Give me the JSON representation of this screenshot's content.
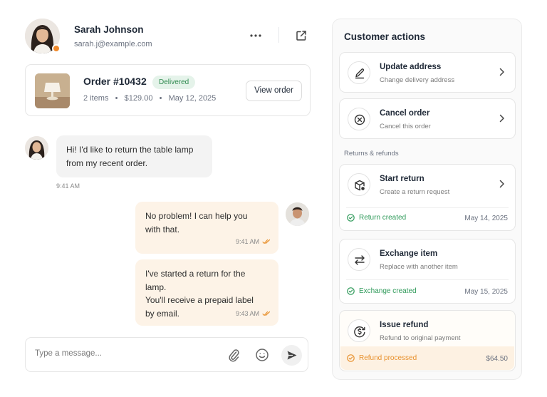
{
  "customer": {
    "name": "Sarah Johnson",
    "email": "sarah.j@example.com",
    "status_color": "#f08a2c"
  },
  "header": {
    "more_icon": "more-horizontal-icon",
    "open_icon": "external-link-icon"
  },
  "order": {
    "title": "Order #10432",
    "status": "Delivered",
    "items": "2 items",
    "total": "$129.00",
    "date": "May 12, 2025",
    "view_label": "View order"
  },
  "messages": [
    {
      "sender": "customer",
      "text": "Hi! I'd like to return the table lamp\nfrom my recent order.",
      "time": "9:41 AM"
    },
    {
      "sender": "agent",
      "text": "No problem! I can help you\nwith that.",
      "time": "9:41 AM"
    },
    {
      "sender": "agent",
      "text": "I've started a return for the lamp.\nYou'll receive a prepaid label\nby email.",
      "time": "9:43 AM"
    }
  ],
  "composer": {
    "placeholder": "Type a message...",
    "icons": [
      "paperclip-icon",
      "emoji-icon",
      "send-icon"
    ]
  },
  "panel": {
    "title": "Customer actions",
    "section_label": "Returns & refunds",
    "actions": [
      {
        "title": "Update address",
        "subtitle": "Change delivery address",
        "icon": "pencil-icon"
      },
      {
        "title": "Cancel order",
        "subtitle": "Cancel this order",
        "icon": "x-circle-icon"
      },
      {
        "title": "Start return",
        "subtitle": "Create a return request",
        "icon": "box-return-icon",
        "status": "Return created",
        "date": "May 14, 2025"
      },
      {
        "title": "Exchange item",
        "subtitle": "Replace with another item",
        "icon": "exchange-arrows-icon",
        "status": "Exchange created",
        "date": "May 15, 2025"
      },
      {
        "title": "Issue refund",
        "subtitle": "Refund to original payment",
        "icon": "dollar-refund-icon",
        "status": "Refund processed",
        "amount": "$64.50"
      }
    ]
  },
  "colors": {
    "success": "#2f9a5a",
    "warning": "#e8912d",
    "agent_bubble": "#fdf3e7",
    "customer_bubble": "#f3f3f3",
    "pill_bg": "#e5f3ea"
  }
}
